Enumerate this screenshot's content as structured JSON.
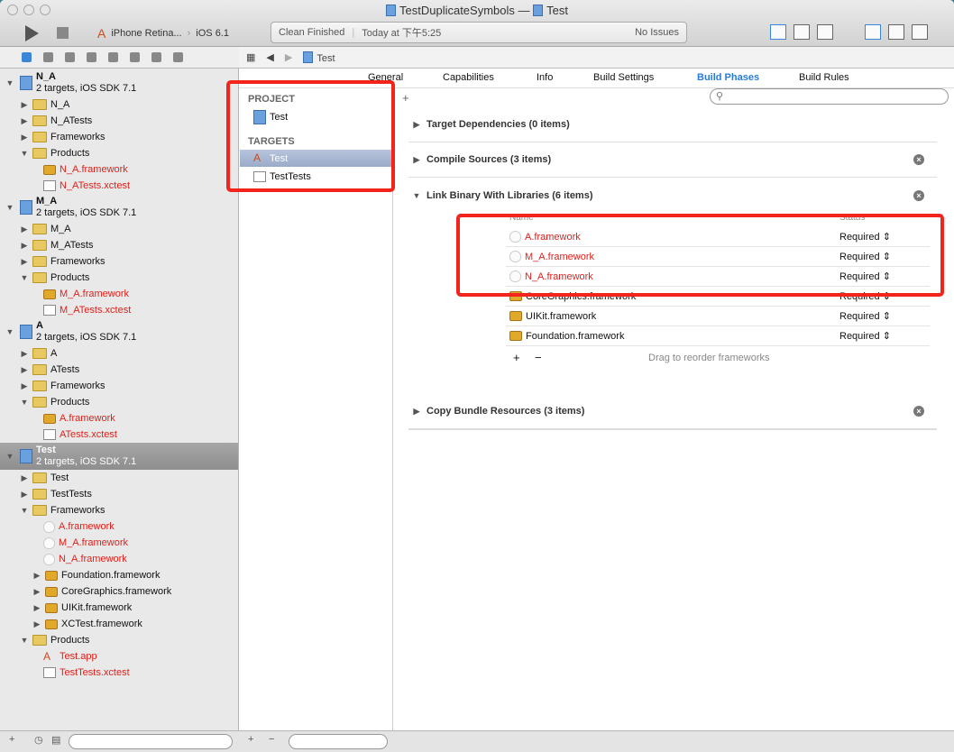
{
  "window": {
    "title": "TestDuplicateSymbols",
    "title_sep": "—",
    "title_file": "Test"
  },
  "toolbar": {
    "scheme": "iPhone Retina...",
    "sdk": "iOS 6.1",
    "activity_status": "Clean Finished",
    "activity_time": "Today at 下午5:25",
    "issues": "No Issues"
  },
  "navigator": {
    "groups": [
      {
        "name": "N_A",
        "subtitle": "2 targets, iOS SDK 7.1",
        "selected": false,
        "items": [
          {
            "label": "N_A",
            "type": "folder",
            "level": 1,
            "open": false
          },
          {
            "label": "N_ATests",
            "type": "folder",
            "level": 1,
            "open": false
          },
          {
            "label": "Frameworks",
            "type": "folder",
            "level": 1,
            "open": false
          },
          {
            "label": "Products",
            "type": "folder",
            "level": 1,
            "open": true
          },
          {
            "label": "N_A.framework",
            "type": "fw",
            "level": 2,
            "red": true
          },
          {
            "label": "N_ATests.xctest",
            "type": "file",
            "level": 2,
            "red": true
          }
        ]
      },
      {
        "name": "M_A",
        "subtitle": "2 targets, iOS SDK 7.1",
        "selected": false,
        "items": [
          {
            "label": "M_A",
            "type": "folder",
            "level": 1,
            "open": false
          },
          {
            "label": "M_ATests",
            "type": "folder",
            "level": 1,
            "open": false
          },
          {
            "label": "Frameworks",
            "type": "folder",
            "level": 1,
            "open": false
          },
          {
            "label": "Products",
            "type": "folder",
            "level": 1,
            "open": true
          },
          {
            "label": "M_A.framework",
            "type": "fw",
            "level": 2,
            "red": true
          },
          {
            "label": "M_ATests.xctest",
            "type": "file",
            "level": 2,
            "red": true
          }
        ]
      },
      {
        "name": "A",
        "subtitle": "2 targets, iOS SDK 7.1",
        "selected": false,
        "items": [
          {
            "label": "A",
            "type": "folder",
            "level": 1,
            "open": false
          },
          {
            "label": "ATests",
            "type": "folder",
            "level": 1,
            "open": false
          },
          {
            "label": "Frameworks",
            "type": "folder",
            "level": 1,
            "open": false
          },
          {
            "label": "Products",
            "type": "folder",
            "level": 1,
            "open": true
          },
          {
            "label": "A.framework",
            "type": "fw",
            "level": 2,
            "red": true
          },
          {
            "label": "ATests.xctest",
            "type": "file",
            "level": 2,
            "red": true
          }
        ]
      },
      {
        "name": "Test",
        "subtitle": "2 targets, iOS SDK 7.1",
        "selected": true,
        "items": [
          {
            "label": "Test",
            "type": "folder",
            "level": 1,
            "open": false
          },
          {
            "label": "TestTests",
            "type": "folder",
            "level": 1,
            "open": false
          },
          {
            "label": "Frameworks",
            "type": "folder",
            "level": 1,
            "open": true
          },
          {
            "label": "A.framework",
            "type": "fwmiss",
            "level": 2,
            "red": true
          },
          {
            "label": "M_A.framework",
            "type": "fwmiss",
            "level": 2,
            "red": true
          },
          {
            "label": "N_A.framework",
            "type": "fwmiss",
            "level": 2,
            "red": true
          },
          {
            "label": "Foundation.framework",
            "type": "fw",
            "level": 2,
            "open": false,
            "tri": true
          },
          {
            "label": "CoreGraphics.framework",
            "type": "fw",
            "level": 2,
            "open": false,
            "tri": true
          },
          {
            "label": "UIKit.framework",
            "type": "fw",
            "level": 2,
            "open": false,
            "tri": true
          },
          {
            "label": "XCTest.framework",
            "type": "fw",
            "level": 2,
            "open": false,
            "tri": true
          },
          {
            "label": "Products",
            "type": "folder",
            "level": 1,
            "open": true
          },
          {
            "label": "Test.app",
            "type": "app",
            "level": 2,
            "red": true
          },
          {
            "label": "TestTests.xctest",
            "type": "file",
            "level": 2,
            "red": true
          }
        ]
      }
    ]
  },
  "jumpbar": {
    "crumb": "Test"
  },
  "tabs": [
    {
      "label": "General"
    },
    {
      "label": "Capabilities"
    },
    {
      "label": "Info"
    },
    {
      "label": "Build Settings"
    },
    {
      "label": "Build Phases",
      "active": true
    },
    {
      "label": "Build Rules"
    }
  ],
  "targets_panel": {
    "project_header": "PROJECT",
    "project": "Test",
    "targets_header": "TARGETS",
    "targets": [
      {
        "label": "Test",
        "selected": true
      },
      {
        "label": "TestTests",
        "selected": false
      }
    ]
  },
  "phases": [
    {
      "title": "Target Dependencies (0 items)",
      "removable": false
    },
    {
      "title": "Compile Sources (3 items)",
      "removable": true
    },
    {
      "title": "Link Binary With Libraries (6 items)",
      "removable": true,
      "open": true
    },
    {
      "title": "Copy Bundle Resources (3 items)",
      "removable": true
    }
  ],
  "libraries": {
    "col_name": "Name",
    "col_status": "Status",
    "rows": [
      {
        "name": "A.framework",
        "status": "Required",
        "missing": true
      },
      {
        "name": "M_A.framework",
        "status": "Required",
        "missing": true
      },
      {
        "name": "N_A.framework",
        "status": "Required",
        "missing": true
      },
      {
        "name": "CoreGraphics.framework",
        "status": "Required"
      },
      {
        "name": "UIKit.framework",
        "status": "Required"
      },
      {
        "name": "Foundation.framework",
        "status": "Required"
      }
    ],
    "hint": "Drag to reorder frameworks",
    "add": "+",
    "remove": "−"
  }
}
